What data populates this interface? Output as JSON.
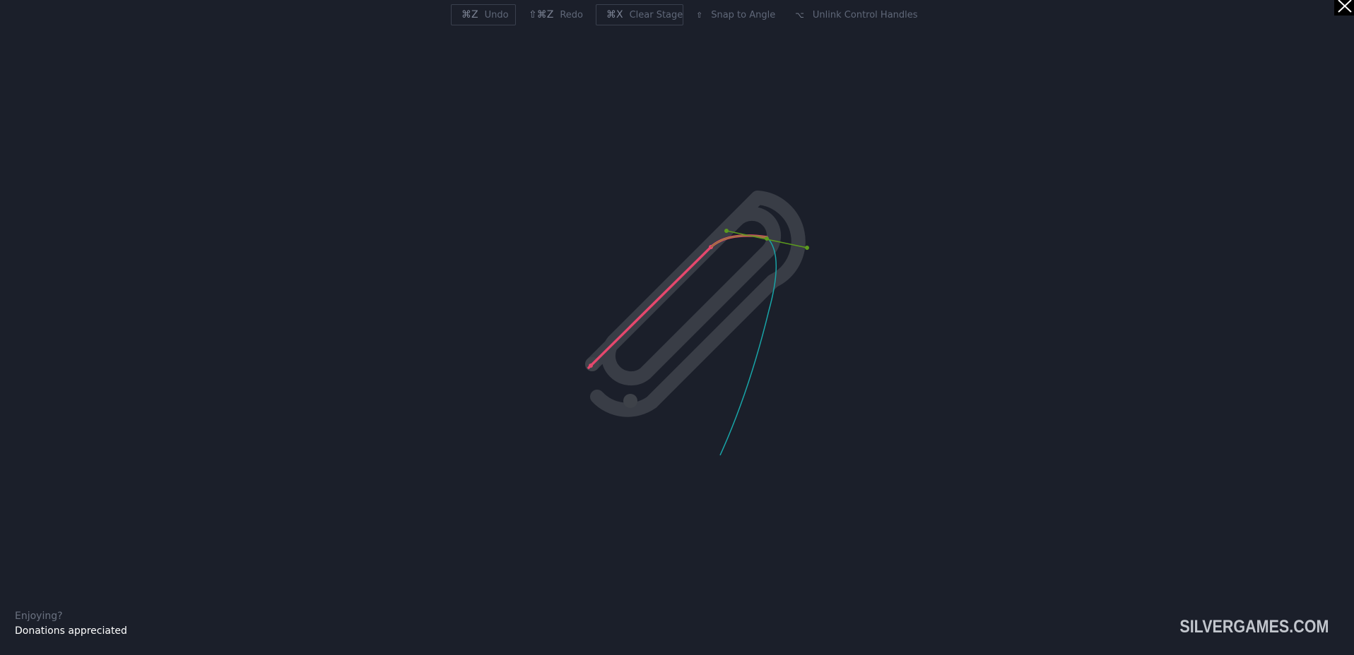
{
  "toolbar": {
    "undo": {
      "key": "⌘Z",
      "label": "Undo"
    },
    "redo": {
      "key": "⇧⌘Z",
      "label": "Redo"
    },
    "clear": {
      "key": "⌘X",
      "label": "Clear Stage"
    },
    "snap": {
      "key": "⇧",
      "label": "Snap to Angle"
    },
    "unlink": {
      "key": "⌥",
      "label": "Unlink Control Handles"
    }
  },
  "close": {
    "icon": "close-icon"
  },
  "footer": {
    "question": "Enjoying?",
    "donate_label": "Donations appreciated",
    "brand": "SILVERGAMES.COM"
  },
  "colors": {
    "background": "#1b1f2a",
    "guide_track": "#3b3f48",
    "drawn_path": "#e5486d",
    "control_handle": "#5c9a1e",
    "preview_curve": "#18a5a8"
  }
}
